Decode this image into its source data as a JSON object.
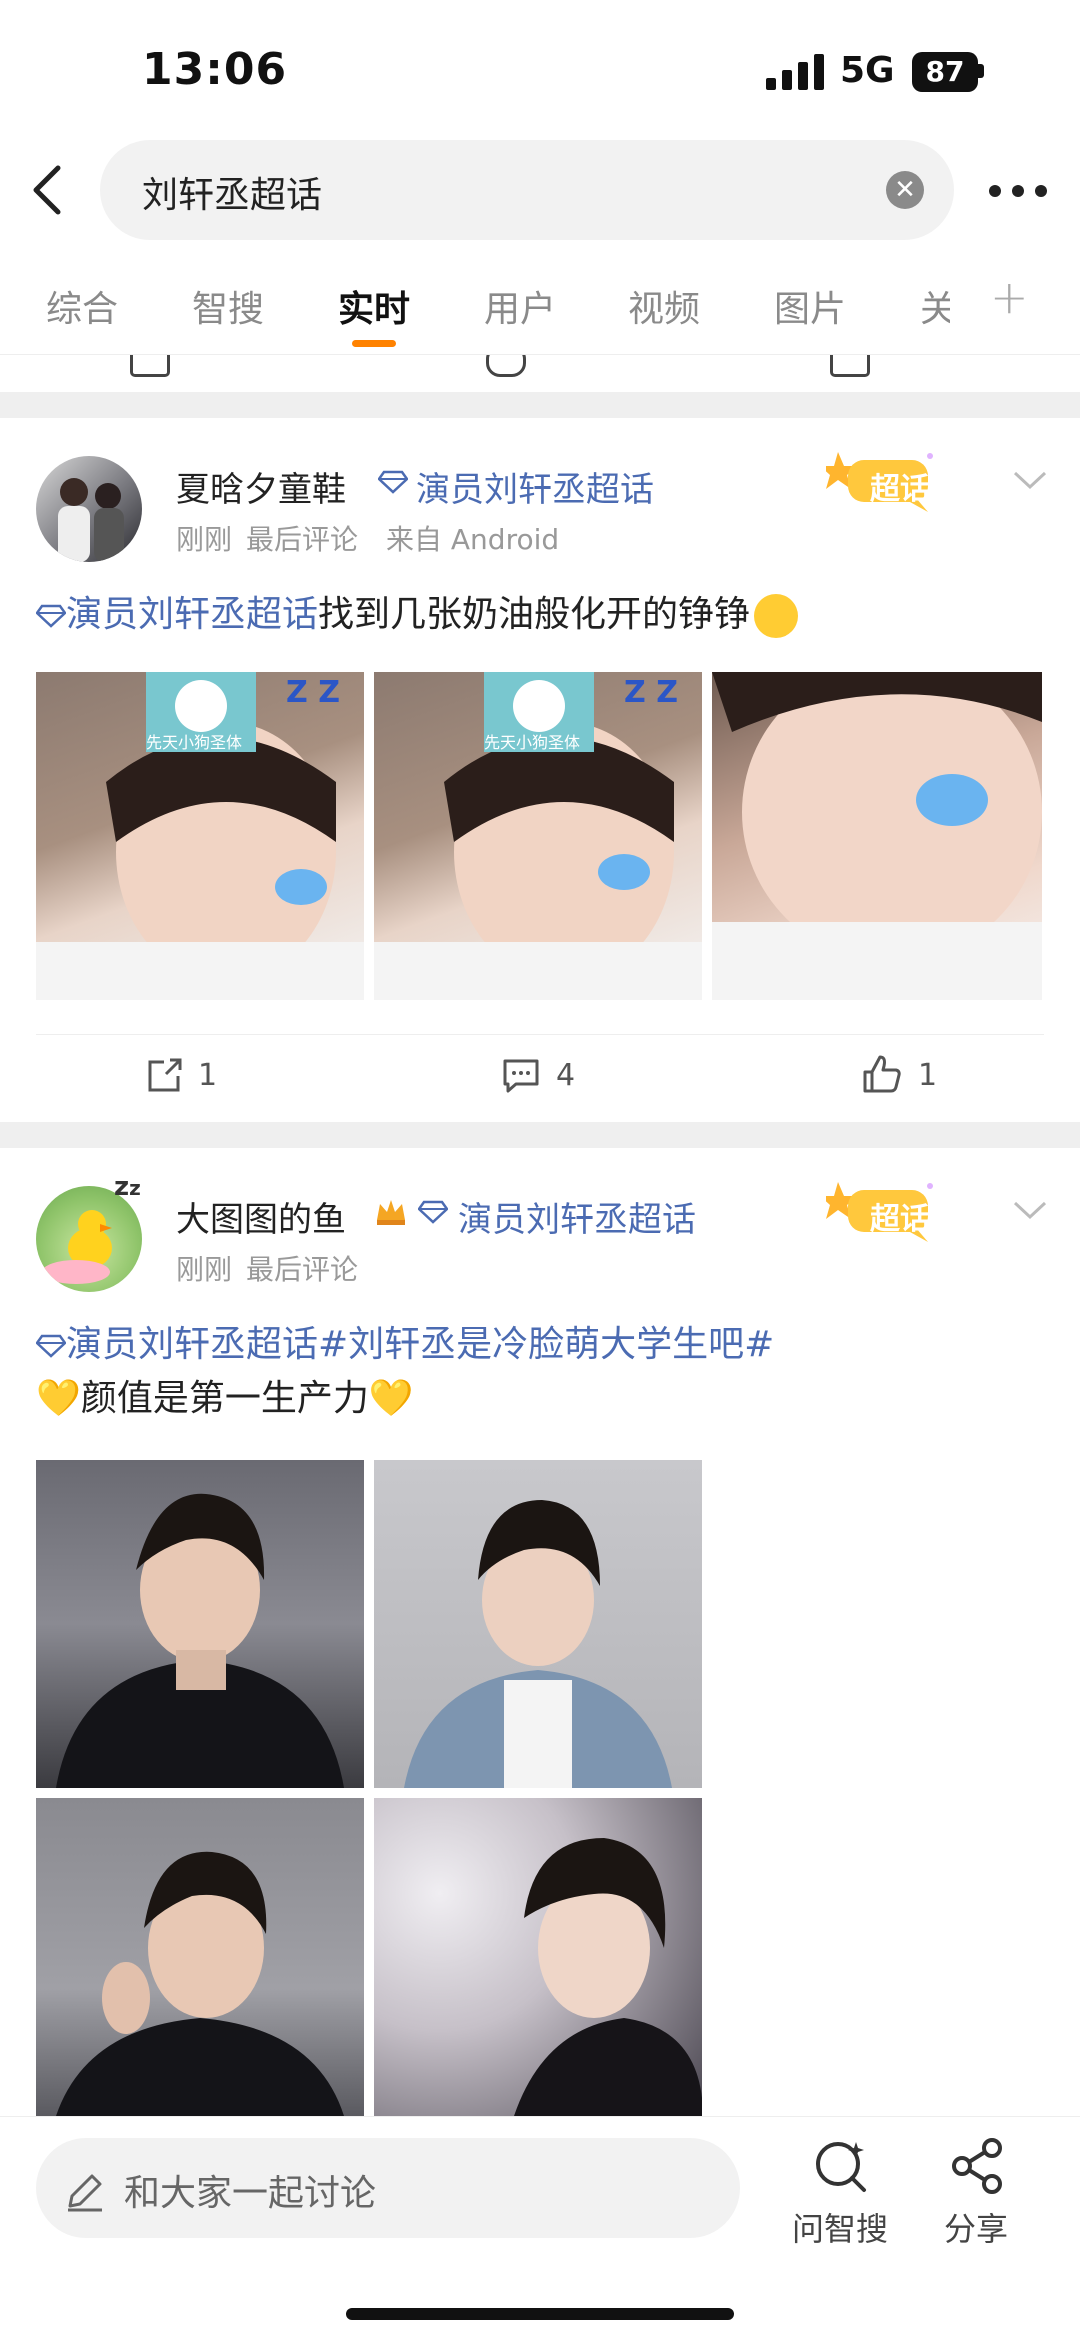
{
  "status_bar": {
    "time": "13:06",
    "network": "5G",
    "battery": "87"
  },
  "header": {
    "search_query": "刘轩丞超话"
  },
  "tabs": [
    {
      "label": "综合"
    },
    {
      "label": "智搜"
    },
    {
      "label": "实时"
    },
    {
      "label": "用户"
    },
    {
      "label": "视频"
    },
    {
      "label": "图片"
    },
    {
      "label": "关"
    }
  ],
  "active_tab": "实时",
  "posts": [
    {
      "username": "夏晗夕童鞋",
      "supertopic": "演员刘轩丞超话",
      "time": "刚刚",
      "last_comment": "最后评论",
      "source": "来自 Android",
      "badge": "超话",
      "text_topic": "演员刘轩丞超话",
      "text_body": "找到几张奶油般化开的铮铮",
      "sticker_text": "先天小狗圣体",
      "actions": {
        "repost": "1",
        "comment": "4",
        "like": "1"
      }
    },
    {
      "username": "大图图的鱼",
      "supertopic": "演员刘轩丞超话",
      "time": "刚刚",
      "last_comment": "最后评论",
      "badge": "超话",
      "text_topic": "演员刘轩丞超话",
      "text_hashtag": "#刘轩丞是冷脸萌大学生吧#",
      "text_body": "颜值是第一生产力"
    }
  ],
  "bottom_bar": {
    "comment_placeholder": "和大家一起讨论",
    "ai_search": "问智搜",
    "share": "分享"
  },
  "colors": {
    "accent": "#ff8200",
    "link": "#4b6bb2",
    "badge": "#ffc83d"
  }
}
